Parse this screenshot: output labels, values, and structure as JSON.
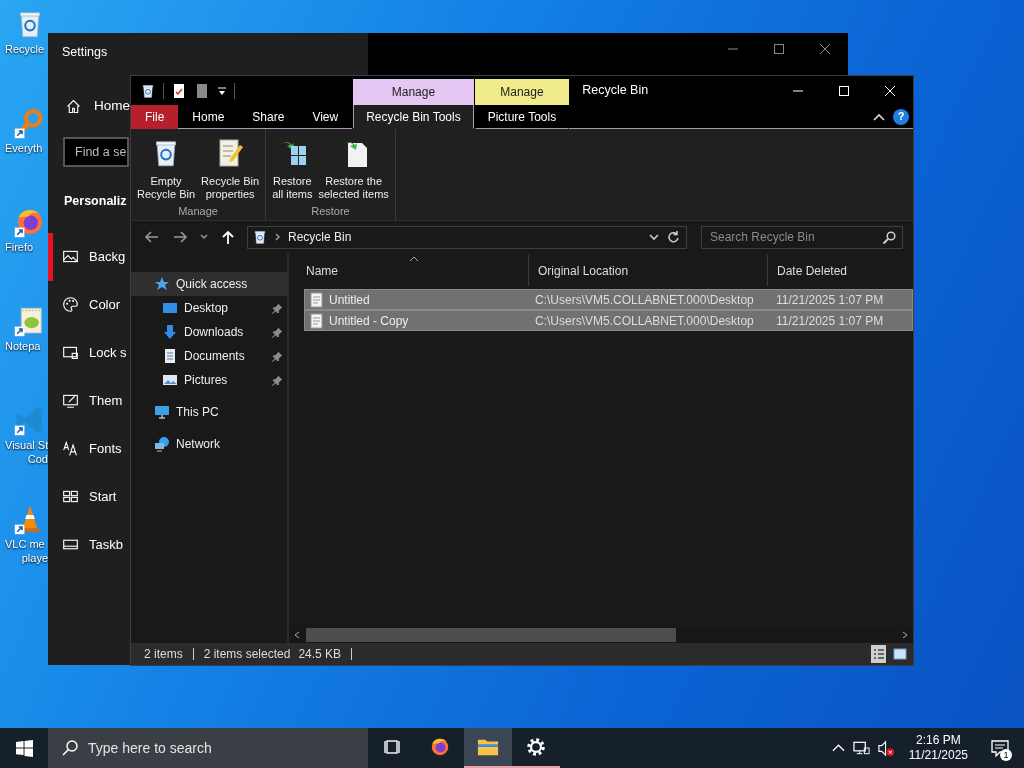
{
  "desktop_icons": [
    {
      "kind": "recycle_bin",
      "lines": [
        "Recycle"
      ],
      "shortcut": false
    },
    {
      "kind": "search_app",
      "lines": [
        "Everyth"
      ],
      "shortcut": true
    },
    {
      "kind": "browser",
      "lines": [
        "Firefo"
      ],
      "shortcut": true
    },
    {
      "kind": "text_editor",
      "lines": [
        "Notepa"
      ],
      "shortcut": true
    },
    {
      "kind": "code_editor",
      "lines": [
        "Visual St",
        "Cod"
      ],
      "shortcut": true
    },
    {
      "kind": "media_player",
      "lines": [
        "VLC me",
        "playe"
      ],
      "shortcut": true
    }
  ],
  "settings_window": {
    "title": "Settings",
    "home": "Home",
    "search": {
      "placeholder": "Find a se"
    },
    "section": "Personaliz",
    "items": [
      {
        "kind": "background",
        "label": "Backg",
        "selected": true
      },
      {
        "kind": "colors",
        "label": "Color",
        "selected": false
      },
      {
        "kind": "lock_screen",
        "label": "Lock s",
        "selected": false
      },
      {
        "kind": "themes",
        "label": "Them",
        "selected": false
      },
      {
        "kind": "fonts",
        "label": "Fonts",
        "selected": false
      },
      {
        "kind": "start",
        "label": "Start",
        "selected": false
      },
      {
        "kind": "taskbar",
        "label": "Taskb",
        "selected": false
      }
    ]
  },
  "explorer": {
    "title": "Recycle Bin",
    "tabs": [
      {
        "kind": "file",
        "label": "File",
        "selected": false
      },
      {
        "kind": "plain",
        "label": "Home",
        "selected": false
      },
      {
        "kind": "plain",
        "label": "Share",
        "selected": false
      },
      {
        "kind": "plain",
        "label": "View",
        "selected": false
      }
    ],
    "contextual_tabs": [
      {
        "group": "Manage",
        "color": "#e6c6f2",
        "label": "Recycle Bin Tools",
        "selected": true
      },
      {
        "group": "Manage",
        "color": "#f0ec8c",
        "label": "Picture Tools",
        "selected": false
      }
    ],
    "help": "?",
    "ribbon_groups": [
      {
        "label": "Manage",
        "commands": [
          {
            "kind": "empty_bin",
            "lines": [
              "Empty",
              "Recycle Bin"
            ]
          },
          {
            "kind": "properties",
            "lines": [
              "Recycle Bin",
              "properties"
            ]
          }
        ]
      },
      {
        "label": "Restore",
        "commands": [
          {
            "kind": "restore_all",
            "lines": [
              "Restore",
              "all items"
            ]
          },
          {
            "kind": "restore_selected",
            "lines": [
              "Restore the",
              "selected items"
            ]
          }
        ]
      }
    ],
    "address": {
      "path": "Recycle Bin"
    },
    "search": {
      "placeholder": "Search Recycle Bin"
    },
    "nav": [
      {
        "kind": "quick_access",
        "label": "Quick access",
        "selected": true,
        "children": [
          {
            "kind": "desktop",
            "label": "Desktop",
            "pinned": true
          },
          {
            "kind": "downloads",
            "label": "Downloads",
            "pinned": true
          },
          {
            "kind": "documents",
            "label": "Documents",
            "pinned": true
          },
          {
            "kind": "pictures",
            "label": "Pictures",
            "pinned": true
          }
        ]
      },
      {
        "kind": "pc",
        "label": "This PC",
        "selected": false
      },
      {
        "kind": "network",
        "label": "Network",
        "selected": false
      }
    ],
    "columns": [
      {
        "label": "Name",
        "sorted": true
      },
      {
        "label": "Original Location",
        "sorted": false
      },
      {
        "label": "Date Deleted",
        "sorted": false
      }
    ],
    "rows": [
      {
        "name": "Untitled",
        "location": "C:\\Users\\VM5.COLLABNET.000\\Desktop",
        "date": "11/21/2025 1:07 PM",
        "selected": true
      },
      {
        "name": "Untitled - Copy",
        "location": "C:\\Users\\VM5.COLLABNET.000\\Desktop",
        "date": "11/21/2025 1:07 PM",
        "selected": true
      }
    ],
    "status": {
      "count": "2 items",
      "selection": "2 items selected",
      "size": "24.5 KB"
    },
    "view_buttons": [
      {
        "kind": "details",
        "selected": true
      },
      {
        "kind": "large_icons",
        "selected": false
      }
    ]
  },
  "taskbar": {
    "search": {
      "placeholder": "Type here to search"
    },
    "apps": [
      {
        "kind": "browser",
        "running": false,
        "active": false
      },
      {
        "kind": "file_explorer",
        "running": true,
        "active": true
      },
      {
        "kind": "settings",
        "running": true,
        "active": false
      }
    ],
    "muted": true,
    "time": "2:16 PM",
    "date": "11/21/2025",
    "notifications": "1"
  }
}
